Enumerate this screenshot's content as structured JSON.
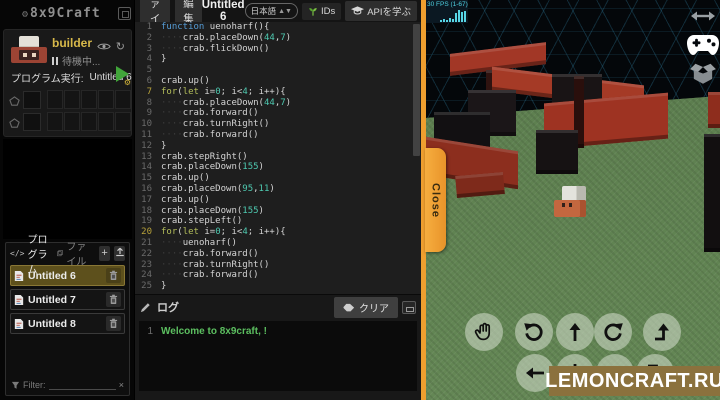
{
  "app": {
    "logo": "8x9Craft"
  },
  "sidebar": {
    "character": {
      "name": "builder",
      "status": "待機中...",
      "run_label": "プログラム実行:",
      "run_target": "Untitled 6"
    },
    "programs": {
      "tab_program_icon": "</>",
      "tab_program": "プログラム",
      "tab_file": "ファイル",
      "add_label": "+",
      "items": [
        {
          "label": "Untitled 6",
          "selected": true
        },
        {
          "label": "Untitled 7",
          "selected": false
        },
        {
          "label": "Untitled 8",
          "selected": false
        }
      ],
      "filter_label": "Filter:",
      "clear_label": "×"
    }
  },
  "menu": {
    "file": "ファイル",
    "edit": "編集",
    "title": "Untitled 6",
    "language": "日本語",
    "ids": "IDs",
    "api": "APIを学ぶ"
  },
  "editor": {
    "highlight_lines": [
      7,
      20
    ],
    "lines": [
      "function uenoharf(){",
      "    crab.placeDown(44,7)",
      "    crab.flickDown()",
      "}",
      "",
      "crab.up()",
      "for(let i=0; i<4; i++){",
      "    crab.placeDown(44,7)",
      "    crab.forward()",
      "    crab.turnRight()",
      "    crab.forward()",
      "}",
      "crab.stepRight()",
      "crab.placeDown(155)",
      "crab.up()",
      "crab.placeDown(95,11)",
      "crab.up()",
      "crab.placeDown(155)",
      "crab.stepLeft()",
      "for(let i=0; i<4; i++){",
      "    uenoharf()",
      "    crab.forward()",
      "    crab.turnRight()",
      "    crab.forward()",
      "}"
    ]
  },
  "log": {
    "title": "ログ",
    "clear": "クリア",
    "lines": [
      {
        "n": 1,
        "text": "Welcome to 8x9craft, !"
      }
    ]
  },
  "game": {
    "fps": "30 FPS (1-67)",
    "close_label": "Close",
    "watermark": "LEMONCRAFT.RU",
    "controls_row1": [
      "grab-hand",
      "rotate-left",
      "move-forward",
      "rotate-right",
      "step-up"
    ],
    "controls_row2": [
      "move-left",
      "move-back",
      "move-right",
      "step-down"
    ]
  },
  "colors": {
    "accent_orange": "#EF9F2F",
    "selected_olive": "#5D501C",
    "name_yellow": "#D7B84A",
    "log_green": "#5CBF60",
    "keyword_blue": "#569CD6",
    "keyword_green": "#B3BD5A",
    "number_teal": "#4EC9B0",
    "grass_green": "#5E8050"
  }
}
